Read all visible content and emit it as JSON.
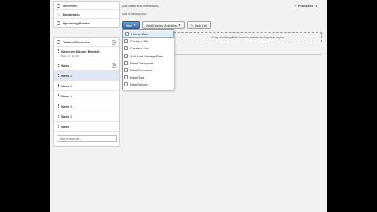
{
  "sidebar": {
    "nav": [
      {
        "label": "Overview",
        "icon": "overview-icon"
      },
      {
        "label": "Bookmarks",
        "icon": "bookmark-icon"
      },
      {
        "label": "Upcoming Events",
        "icon": "calendar-icon"
      }
    ],
    "toc": {
      "title": "Table of Contents",
      "count": "0",
      "rows": [
        {
          "label": "Welcome Module Breakfit",
          "sub": "New: 12 · Jul 18"
        },
        {
          "label": "Week 1",
          "badge": "0"
        },
        {
          "label": "Week 2",
          "selected": true
        },
        {
          "label": "Week 3"
        },
        {
          "label": "Week 4"
        },
        {
          "label": "Week 5"
        },
        {
          "label": "Week 6"
        },
        {
          "label": "Week 7"
        }
      ],
      "add_module_placeholder": "Add a module..."
    }
  },
  "main": {
    "top_text": "Add dates and restrictions...",
    "add_description": "Add a description...",
    "visibility": "Published",
    "toolbar": {
      "new_button": "New",
      "add_existing_button": "Add Existing Activities",
      "bulk_edit_button": "Bulk Edit"
    },
    "dropzone_text": "Drag and drop files here to create and update topics",
    "menu": [
      "Upload Files",
      "Create a File",
      "Create a Link",
      "Add from Manage Files",
      "New Checkpoint",
      "New Discussion",
      "New Quiz",
      "New Survey"
    ]
  }
}
